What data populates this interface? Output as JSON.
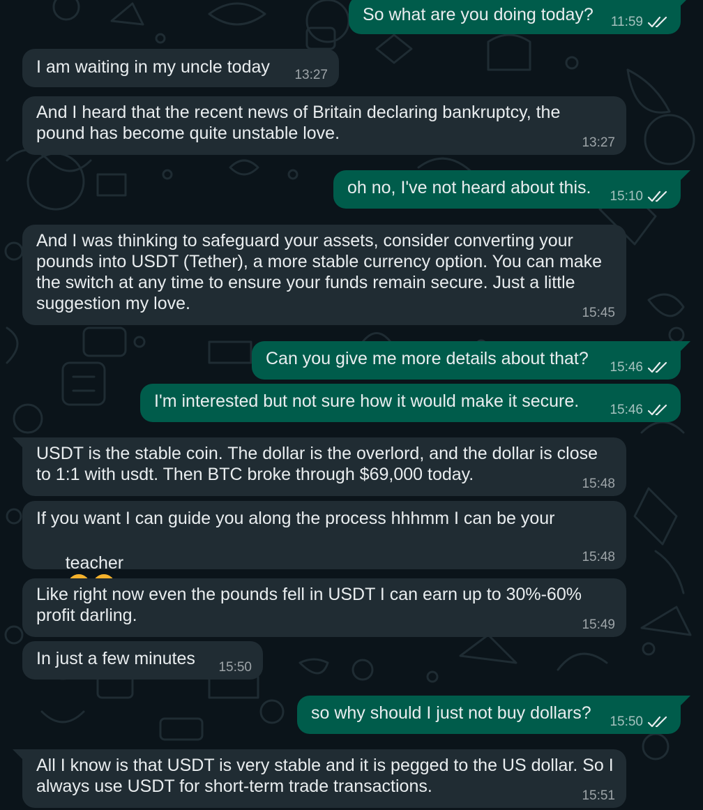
{
  "colors": {
    "background": "#0b141a",
    "incoming_bubble": "#202c33",
    "outgoing_bubble": "#005c4b",
    "text": "#e9edef",
    "read_receipt": "#e9edef"
  },
  "messages": [
    {
      "direction": "outgoing",
      "text": "So what are you doing today?",
      "time": "11:59",
      "status_icon": "double-check-icon"
    },
    {
      "direction": "incoming",
      "text": "I am waiting in my uncle today",
      "time": "13:27"
    },
    {
      "direction": "incoming",
      "text": "And I heard that the recent news of Britain declaring bankruptcy, the pound has become quite unstable love.",
      "time": "13:27"
    },
    {
      "direction": "outgoing",
      "text": "oh no, I've not heard about this.",
      "time": "15:10",
      "status_icon": "double-check-icon"
    },
    {
      "direction": "incoming",
      "text": "And I was thinking to safeguard your assets, consider converting your pounds into USDT (Tether), a more stable currency option. You can make the switch at any time to ensure your funds remain secure. Just a little suggestion my love.",
      "time": "15:45"
    },
    {
      "direction": "outgoing",
      "text": "Can you give me more details about that?",
      "time": "15:46",
      "status_icon": "double-check-icon"
    },
    {
      "direction": "outgoing",
      "text": "I'm interested but not sure how it would make it secure.",
      "time": "15:46",
      "status_icon": "double-check-icon"
    },
    {
      "direction": "incoming",
      "text": "USDT is the stable coin. The dollar is the overlord, and the dollar is close to 1:1 with usdt. Then BTC broke through $69,000 today.",
      "time": "15:48"
    },
    {
      "direction": "incoming",
      "text": "If you want I can guide you along the process hhhmm I can be your",
      "text_line2": "teacher",
      "emojis": [
        "kissing-face-with-closed-eyes-emoji",
        "kissing-face-with-closed-eyes-emoji"
      ],
      "time": "15:48"
    },
    {
      "direction": "incoming",
      "text": "Like right now even the pounds fell in USDT I can earn up to 30%-60% profit darling.",
      "time": "15:49"
    },
    {
      "direction": "incoming",
      "text": "In just a few minutes",
      "time": "15:50"
    },
    {
      "direction": "outgoing",
      "text": "so why should I just not buy dollars?",
      "time": "15:50",
      "status_icon": "double-check-icon"
    },
    {
      "direction": "incoming",
      "text": "All I know is that USDT is very stable and it is pegged to the US dollar. So I always use USDT for short-term trade transactions.",
      "time": "15:51"
    }
  ]
}
